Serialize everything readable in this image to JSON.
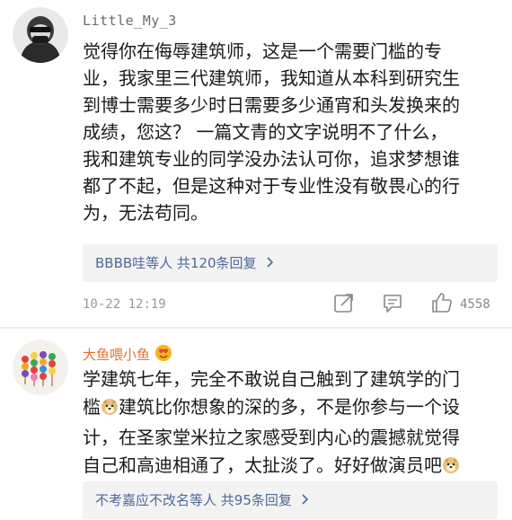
{
  "comments": [
    {
      "username": "Little_My_3",
      "lines": [
        "觉得你在侮辱建筑师，这是一个需要门槛的专",
        "业，我家里三代建筑师，我知道从本科到研究生",
        "到博士需要多少时日需要多少通宵和头发换来的",
        "成绩，您这？ 一篇文青的文字说明不了什么，",
        "我和建筑专业的同学没办法认可你，追求梦想谁",
        "都了不起，但是这种对于专业性没有敬畏心的行",
        "为，无法苟同。"
      ],
      "reply_summary": "BBBB哇等人 共120条回复",
      "timestamp": "10-22 12:19",
      "like_count": "4558",
      "actions": [
        "share-icon",
        "comment-icon",
        "like-icon"
      ]
    },
    {
      "username": "大鱼喂小鱼",
      "username_badge": "emoji-badge-icon",
      "line1": "学建筑七年，完全不敢说自己触到了建筑学的门",
      "line2_a": "槛",
      "line2_emoji": "doge-emoji-icon",
      "line2_b": "建筑比你想象的深的多，不是你参与一个设",
      "line3": "计，在圣家堂米拉之家感受到内心的震撼就觉得",
      "line4": "自己和高迪相通了，太扯淡了。好好做演员吧",
      "line4_emoji": "doge-emoji-icon",
      "reply_summary": "不考嘉应不改名等人 共95条回复"
    }
  ],
  "colors": {
    "username_gray": "#6b6b6b",
    "username_orange": "#e8712a",
    "link_blue": "#4d6a99",
    "meta_gray": "#999999",
    "reply_bg": "#f3f3f3"
  }
}
